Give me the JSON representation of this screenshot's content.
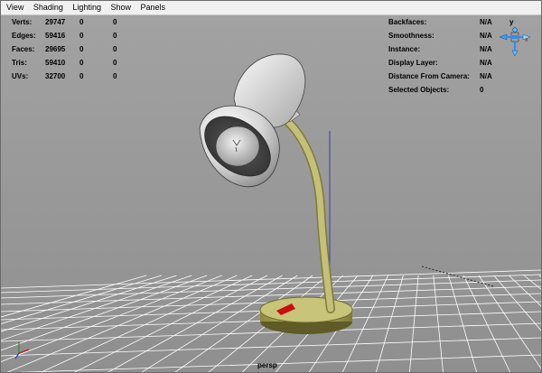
{
  "menu": [
    "View",
    "Shading",
    "Lighting",
    "Show",
    "Panels"
  ],
  "stats": [
    {
      "label": "Verts:",
      "a": "29747",
      "b": "0",
      "c": "0"
    },
    {
      "label": "Edges:",
      "a": "59416",
      "b": "0",
      "c": "0"
    },
    {
      "label": "Faces:",
      "a": "29695",
      "b": "0",
      "c": "0"
    },
    {
      "label": "Tris:",
      "a": "59410",
      "b": "0",
      "c": "0"
    },
    {
      "label": "UVs:",
      "a": "32700",
      "b": "0",
      "c": "0"
    }
  ],
  "info": [
    {
      "label": "Backfaces:",
      "value": "N/A"
    },
    {
      "label": "Smoothness:",
      "value": "N/A"
    },
    {
      "label": "Instance:",
      "value": "N/A"
    },
    {
      "label": "Display Layer:",
      "value": "N/A"
    },
    {
      "label": "Distance From Camera:",
      "value": "N/A"
    },
    {
      "label": "Selected Objects:",
      "value": "0"
    }
  ],
  "viewcube_axis": "y",
  "camera_name": "persp",
  "colors": {
    "viewport_bg": "#9b9b9b",
    "grid": "#ffffff",
    "lamp_shade": "#d9d9d9",
    "lamp_stem": "#a6a259"
  }
}
